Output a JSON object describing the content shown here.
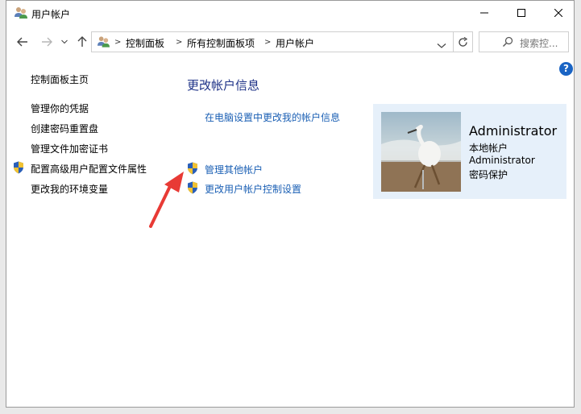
{
  "window": {
    "title": "用户帐户"
  },
  "address_bar": {
    "crumbs": [
      "控制面板",
      "所有控制面板项",
      "用户帐户"
    ]
  },
  "search": {
    "placeholder": "搜索控..."
  },
  "sidebar": {
    "home": "控制面板主页",
    "items": [
      {
        "label": "管理你的凭据",
        "shield": false
      },
      {
        "label": "创建密码重置盘",
        "shield": false
      },
      {
        "label": "管理文件加密证书",
        "shield": false
      },
      {
        "label": "配置高级用户配置文件属性",
        "shield": true
      },
      {
        "label": "更改我的环境变量",
        "shield": false
      }
    ]
  },
  "main": {
    "title": "更改帐户信息",
    "pc_settings_link": "在电脑设置中更改我的帐户信息",
    "manage_other": "管理其他帐户",
    "uac_settings": "更改用户帐户控制设置"
  },
  "account": {
    "name": "Administrator",
    "type": "本地帐户",
    "group": "Administrator",
    "password": "密码保护"
  },
  "colors": {
    "link": "#1a5fb4",
    "title": "#1e3287",
    "panel_bg": "#e6f0fa",
    "arrow": "#e83a35"
  }
}
